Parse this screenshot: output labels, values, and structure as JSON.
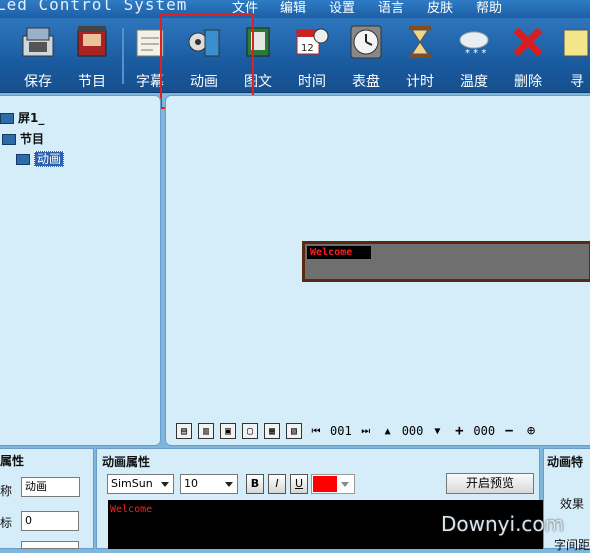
{
  "app": {
    "title": "Led Control System"
  },
  "menu": [
    "文件",
    "编辑",
    "设置",
    "语言",
    "皮肤",
    "帮助"
  ],
  "toolbar": {
    "items": [
      {
        "label": "保存"
      },
      {
        "label": "节目"
      },
      {
        "label": "字幕"
      },
      {
        "label": "动画"
      },
      {
        "label": "图文"
      },
      {
        "label": "时间"
      },
      {
        "label": "表盘"
      },
      {
        "label": "计时"
      },
      {
        "label": "温度"
      },
      {
        "label": "删除"
      },
      {
        "label": "寻"
      }
    ]
  },
  "tree": {
    "screen": "屏1_",
    "program": "节目",
    "animation": "动画"
  },
  "canvas": {
    "welcome": "Welcome"
  },
  "nav": {
    "page": "001",
    "v1": "000",
    "v2": "000"
  },
  "left_props": {
    "title": "属性",
    "name_label": "称",
    "name_value": "动画",
    "x_label": "标",
    "x_value": "0"
  },
  "anim_props": {
    "title": "动画属性",
    "font": "SimSun",
    "size": "10",
    "bold": "B",
    "italic": "I",
    "underline": "U",
    "color": "#ff0000",
    "preview_button": "开启预览",
    "preview_text": "Welcome"
  },
  "effects": {
    "title": "动画特",
    "effect_label": "效果",
    "spacing_label": "字间距"
  },
  "watermark": "Downyi.com"
}
